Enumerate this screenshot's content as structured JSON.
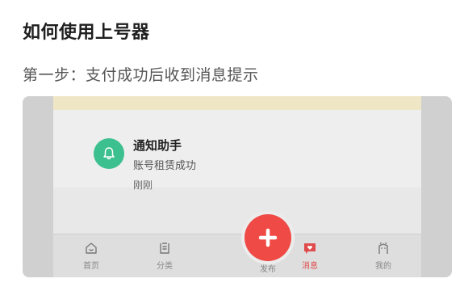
{
  "heading": "如何使用上号器",
  "step_text": "第一步：支付成功后收到消息提示",
  "notification": {
    "title": "通知助手",
    "message": "账号租赁成功",
    "time": "刚刚",
    "icon": "bell-icon"
  },
  "tabs": [
    {
      "label": "首页",
      "icon": "home-icon",
      "active": false
    },
    {
      "label": "分类",
      "icon": "category-icon",
      "active": false
    },
    {
      "label": "发布",
      "icon": "plus-icon",
      "active": false
    },
    {
      "label": "消息",
      "icon": "message-icon",
      "active": true
    },
    {
      "label": "我的",
      "icon": "profile-icon",
      "active": false
    }
  ],
  "colors": {
    "accent": "#ef4a45",
    "notification_icon_bg": "#3cc08f",
    "banner": "#efe6c6"
  }
}
